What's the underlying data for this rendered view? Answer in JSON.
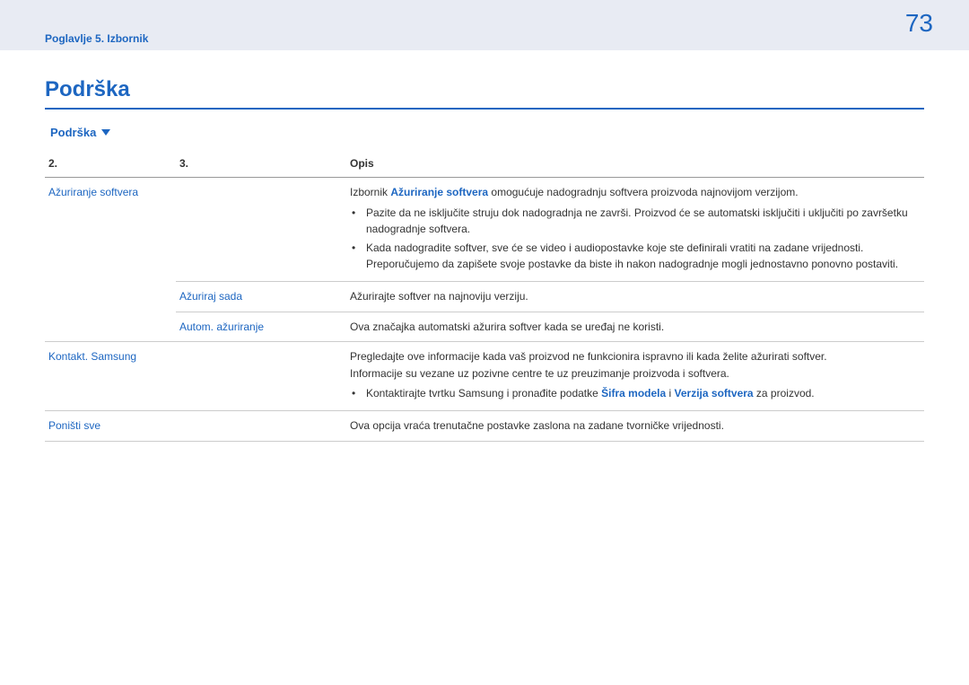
{
  "header": {
    "chapter": "Poglavlje 5. Izbornik",
    "page": "73"
  },
  "title": "Podrška",
  "section": "Podrška",
  "table": {
    "head": {
      "c2": "2.",
      "c3": "3.",
      "desc": "Opis"
    },
    "r1": {
      "c2": "Ažuriranje softvera",
      "desc_pre": "Izbornik ",
      "desc_em": "Ažuriranje softvera",
      "desc_post": " omogućuje nadogradnju softvera proizvoda najnovijom verzijom.",
      "b1": "Pazite da ne isključite struju dok nadogradnja ne završi. Proizvod će se automatski isključiti i uključiti po završetku nadogradnje softvera.",
      "b2": "Kada nadogradite softver, sve će se video i audiopostavke koje ste definirali vratiti na zadane vrijednosti. Preporučujemo da zapišete svoje postavke da biste ih nakon nadogradnje mogli jednostavno ponovno postaviti."
    },
    "r2": {
      "c3": "Ažuriraj sada",
      "desc": "Ažurirajte softver na najnoviju verziju."
    },
    "r3": {
      "c3": "Autom. ažuriranje",
      "desc": "Ova značajka automatski ažurira softver kada se uređaj ne koristi."
    },
    "r4": {
      "c2": "Kontakt. Samsung",
      "line1": "Pregledajte ove informacije kada vaš proizvod ne funkcionira ispravno ili kada želite ažurirati softver.",
      "line2": "Informacije su vezane uz pozivne centre te uz preuzimanje proizvoda i softvera.",
      "b_pre": "Kontaktirajte tvrtku Samsung i pronađite podatke ",
      "b_em1": "Šifra modela",
      "b_mid": " i ",
      "b_em2": "Verzija softvera",
      "b_post": " za proizvod."
    },
    "r5": {
      "c2": "Poništi sve",
      "desc": "Ova opcija vraća trenutačne postavke zaslona na zadane tvorničke vrijednosti."
    }
  }
}
